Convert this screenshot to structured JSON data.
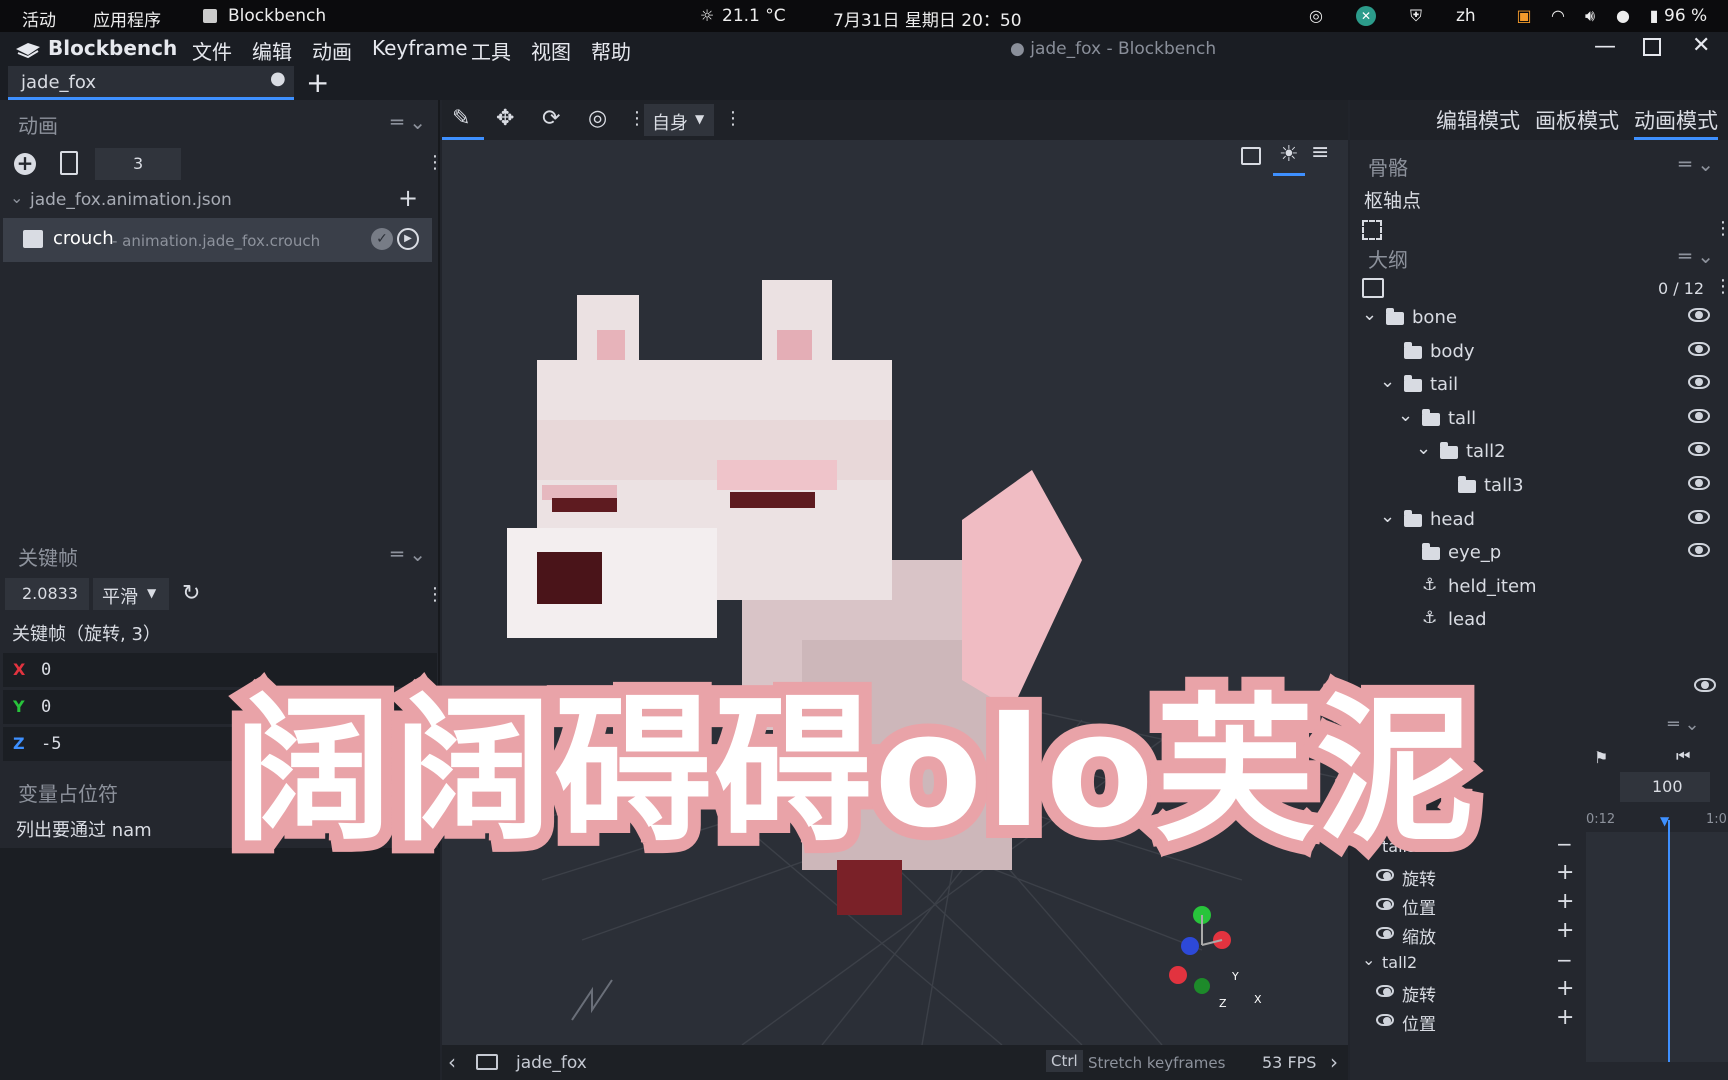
{
  "topbar": {
    "activities": "活动",
    "applications": "应用程序",
    "app_name": "Blockbench",
    "weather": "21.1 °C",
    "datetime": "7月31日 星期日  20：50",
    "input_method": "zh",
    "battery": "96 %"
  },
  "menubar": {
    "brand": "Blockbench",
    "items": [
      "文件",
      "编辑",
      "动画",
      "Keyframe",
      "工具",
      "视图",
      "帮助"
    ],
    "window_title": "● jade_fox - Blockbench"
  },
  "tabs": [
    {
      "label": "jade_fox"
    }
  ],
  "left": {
    "animation_header": "动画",
    "anim_count_value": "3",
    "file_name": "jade_fox.animation.json",
    "anim_item": {
      "name": "crouch",
      "sub": "- animation.jade_fox.crouch"
    },
    "keyframe_header": "关键帧",
    "keyframe_time": "2.0833",
    "interpolation": "平滑",
    "keyframe_title": "关键帧（旋转, 3）",
    "axes": [
      {
        "axis": "X",
        "value": "0",
        "color": "#e2333f"
      },
      {
        "axis": "Y",
        "value": "0",
        "color": "#28c43b"
      },
      {
        "axis": "Z",
        "value": "-5",
        "color": "#3e90ff"
      }
    ],
    "placeholder_header": "变量占位符",
    "placeholder_text": "列出要通过 nam"
  },
  "viewport": {
    "transform_space": "自身",
    "status_label": "jade_fox",
    "ctrl_key": "Ctrl",
    "ctrl_hint": "Stretch keyframes",
    "fps": "53 FPS",
    "axis_x": "X",
    "axis_y": "Y",
    "axis_z": "Z"
  },
  "right": {
    "modes": [
      "编辑模式",
      "画板模式",
      "动画模式"
    ],
    "skeleton_header": "骨骼",
    "pivot_label": "枢轴点",
    "outline_header": "大纲",
    "outline_count": "0 / 12",
    "tree": [
      {
        "name": "bone",
        "indent": 0,
        "type": "folder",
        "expanded": true,
        "eye": true
      },
      {
        "name": "body",
        "indent": 1,
        "type": "folder",
        "expanded": false,
        "eye": true
      },
      {
        "name": "tail",
        "indent": 1,
        "type": "folder",
        "expanded": true,
        "eye": true
      },
      {
        "name": "tall",
        "indent": 2,
        "type": "folder",
        "expanded": true,
        "eye": true
      },
      {
        "name": "tall2",
        "indent": 3,
        "type": "folder",
        "expanded": true,
        "eye": true
      },
      {
        "name": "tall3",
        "indent": 4,
        "type": "folder",
        "expanded": false,
        "eye": true
      },
      {
        "name": "head",
        "indent": 1,
        "type": "folder",
        "expanded": true,
        "eye": true
      },
      {
        "name": "eye_p",
        "indent": 2,
        "type": "folder",
        "expanded": false,
        "eye": true
      },
      {
        "name": "held_item",
        "indent": 2,
        "type": "locator",
        "expanded": false,
        "eye": false
      },
      {
        "name": "lead",
        "indent": 2,
        "type": "locator",
        "expanded": false,
        "eye": false
      }
    ],
    "timeline": {
      "length": "100",
      "time_prefix": "0:0",
      "tick_a": "0:12",
      "tick_b": "1:0",
      "groups": [
        {
          "name": "tall3",
          "channels": [
            "旋转",
            "位置",
            "缩放"
          ]
        },
        {
          "name": "tall2",
          "channels": [
            "旋转",
            "位置"
          ]
        }
      ]
    }
  },
  "caption": {
    "text": "阔阔碍碍oIo芙泥"
  },
  "colors": {
    "accent": "#3e90ff",
    "caption_fill": "#ffffff",
    "caption_outline": "#e9a3a8"
  }
}
